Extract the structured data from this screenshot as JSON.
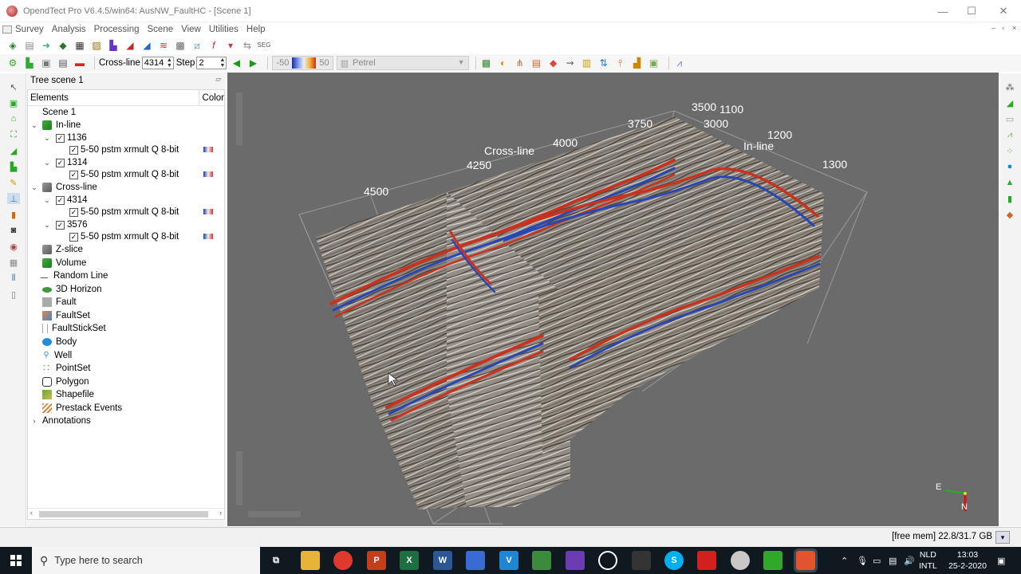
{
  "window": {
    "title": "OpendTect Pro V6.4.5/win64: AusNW_FaultHC - [Scene 1]",
    "minimize": "—",
    "maximize": "☐",
    "close": "✕"
  },
  "menu": [
    "Survey",
    "Analysis",
    "Processing",
    "Scene",
    "View",
    "Utilities",
    "Help"
  ],
  "slice_toolbar": {
    "crossline_label": "Cross-line",
    "crossline_value": "4314",
    "step_label": "Step",
    "step_value": "2",
    "color_min": "-50",
    "color_max": "50",
    "colormap": "Petrel"
  },
  "tree": {
    "panel_title": "Tree scene 1",
    "col_elements": "Elements",
    "col_color": "Color",
    "scene": "Scene 1",
    "inline": {
      "label": "In-line",
      "items": [
        {
          "number": "1136",
          "attribute": "5-50 pstm xrmult Q 8-bit"
        },
        {
          "number": "1314",
          "attribute": "5-50 pstm xrmult Q 8-bit"
        }
      ]
    },
    "crossline": {
      "label": "Cross-line",
      "items": [
        {
          "number": "4314",
          "attribute": "5-50 pstm xrmult Q 8-bit"
        },
        {
          "number": "3576",
          "attribute": "5-50 pstm xrmult Q 8-bit"
        }
      ]
    },
    "elements": [
      "Z-slice",
      "Volume",
      "Random Line",
      "3D Horizon",
      "Fault",
      "FaultSet",
      "FaultStickSet",
      "Body",
      "Well",
      "PointSet",
      "Polygon",
      "Shapefile",
      "Prestack Events"
    ],
    "annotations": "Annotations"
  },
  "viewport": {
    "crossline_axis_label": "Cross-line",
    "inline_axis_label": "In-line",
    "crossline_ticks": [
      "4500",
      "4250",
      "4000",
      "3750",
      "3500"
    ],
    "inline_ticks": [
      "1100",
      "1200",
      "1300"
    ],
    "z_tick": "3000",
    "compass_e": "E",
    "compass_n": "N"
  },
  "status": {
    "memory": "[free mem] 22.8/31.7 GB"
  },
  "taskbar": {
    "search_placeholder": "Type here to search",
    "lang": "NLD",
    "lang2": "INTL",
    "time": "13:03",
    "date": "25-2-2020"
  },
  "colors": {
    "seismic_red": "#c8321e",
    "seismic_blue": "#2846b4",
    "viewport_bg": "#6b6b6b",
    "taskbar": "#101820"
  }
}
